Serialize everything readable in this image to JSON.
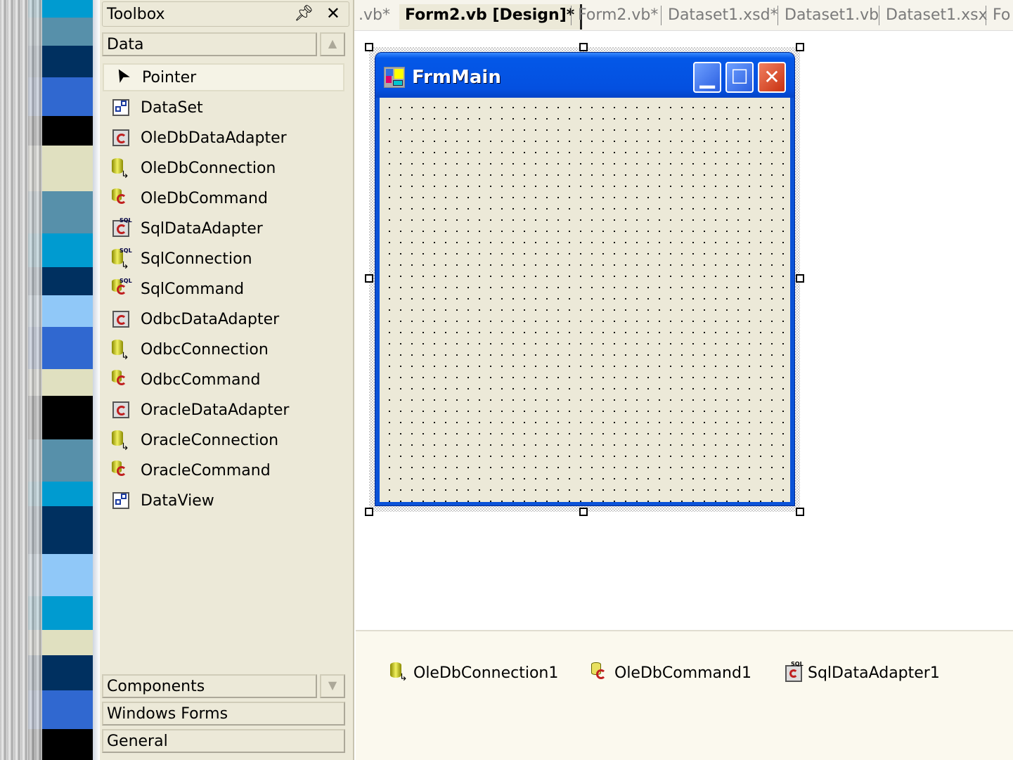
{
  "toolbox": {
    "title": "Toolbox",
    "pin_icon": "pin-icon",
    "close_icon": "close-icon",
    "active_category": "Data",
    "items": [
      {
        "label": "Pointer",
        "icon": "pointer-icon"
      },
      {
        "label": "DataSet",
        "icon": "dataset-icon"
      },
      {
        "label": "OleDbDataAdapter",
        "icon": "adapter-icon"
      },
      {
        "label": "OleDbConnection",
        "icon": "connection-icon"
      },
      {
        "label": "OleDbCommand",
        "icon": "command-icon"
      },
      {
        "label": "SqlDataAdapter",
        "icon": "sql-adapter-icon"
      },
      {
        "label": "SqlConnection",
        "icon": "sql-connection-icon"
      },
      {
        "label": "SqlCommand",
        "icon": "sql-command-icon"
      },
      {
        "label": "OdbcDataAdapter",
        "icon": "adapter-icon"
      },
      {
        "label": "OdbcConnection",
        "icon": "connection-icon"
      },
      {
        "label": "OdbcCommand",
        "icon": "command-icon"
      },
      {
        "label": "OracleDataAdapter",
        "icon": "adapter-icon"
      },
      {
        "label": "OracleConnection",
        "icon": "connection-icon"
      },
      {
        "label": "OracleCommand",
        "icon": "command-icon"
      },
      {
        "label": "DataView",
        "icon": "dataview-icon"
      }
    ],
    "bottom_categories": [
      "Components",
      "Windows Forms",
      "General"
    ]
  },
  "tabs": [
    ".vb*",
    "Form2.vb [Design]*",
    "Form2.vb*",
    "Dataset1.xsd*",
    "Dataset1.vb",
    "Dataset1.xsx",
    "Fo"
  ],
  "form": {
    "title": "FrmMain"
  },
  "tray": [
    "OleDbConnection1",
    "OleDbCommand1",
    "SqlDataAdapter1"
  ]
}
